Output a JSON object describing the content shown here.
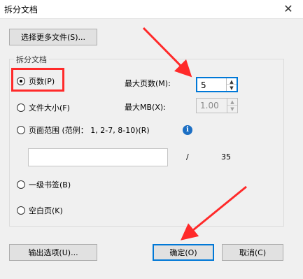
{
  "window": {
    "title": "拆分文档",
    "close_glyph": "✕"
  },
  "toolbar": {
    "select_more_files": "选择更多文件(S)..."
  },
  "group": {
    "label": "拆分文档"
  },
  "options": {
    "pages": "页数(P)",
    "file_size": "文件大小(F)",
    "page_range": "页面范围 (范例： 1, 2-7, 8-10)(R)",
    "bookmark": "一级书签(B)",
    "blank_page": "空白页(K)"
  },
  "fields": {
    "max_pages_label": "最大页数(M):",
    "max_pages_value": "5",
    "max_mb_label": "最大MB(X):",
    "max_mb_value": "1.00"
  },
  "range": {
    "separator": "/",
    "total": "35",
    "value": ""
  },
  "buttons": {
    "output": "输出选项(U)...",
    "ok": "确定(O)",
    "cancel": "取消(C)"
  },
  "icons": {
    "info": "i",
    "spin_up": "▲",
    "spin_down": "▼"
  },
  "colors": {
    "annotation": "#ff2a2a",
    "accent": "#0078d7",
    "info": "#1c6fc4"
  }
}
